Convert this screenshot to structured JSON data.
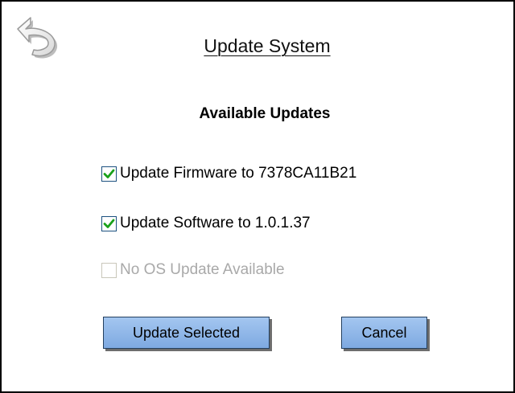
{
  "dialog": {
    "title": "Update System",
    "subtitle": "Available Updates",
    "back_icon": "undo-arrow-icon"
  },
  "options": [
    {
      "label": "Update Firmware to 7378CA11B21",
      "checked": true,
      "enabled": true
    },
    {
      "label": "Update Software to 1.0.1.37",
      "checked": true,
      "enabled": true
    },
    {
      "label": "No OS Update Available",
      "checked": false,
      "enabled": false
    }
  ],
  "buttons": {
    "update_label": "Update Selected",
    "cancel_label": "Cancel"
  },
  "colors": {
    "checkmark": "#1aa11a",
    "button_fill": "#8fb5e8",
    "disabled_text": "#a9a9a9"
  }
}
